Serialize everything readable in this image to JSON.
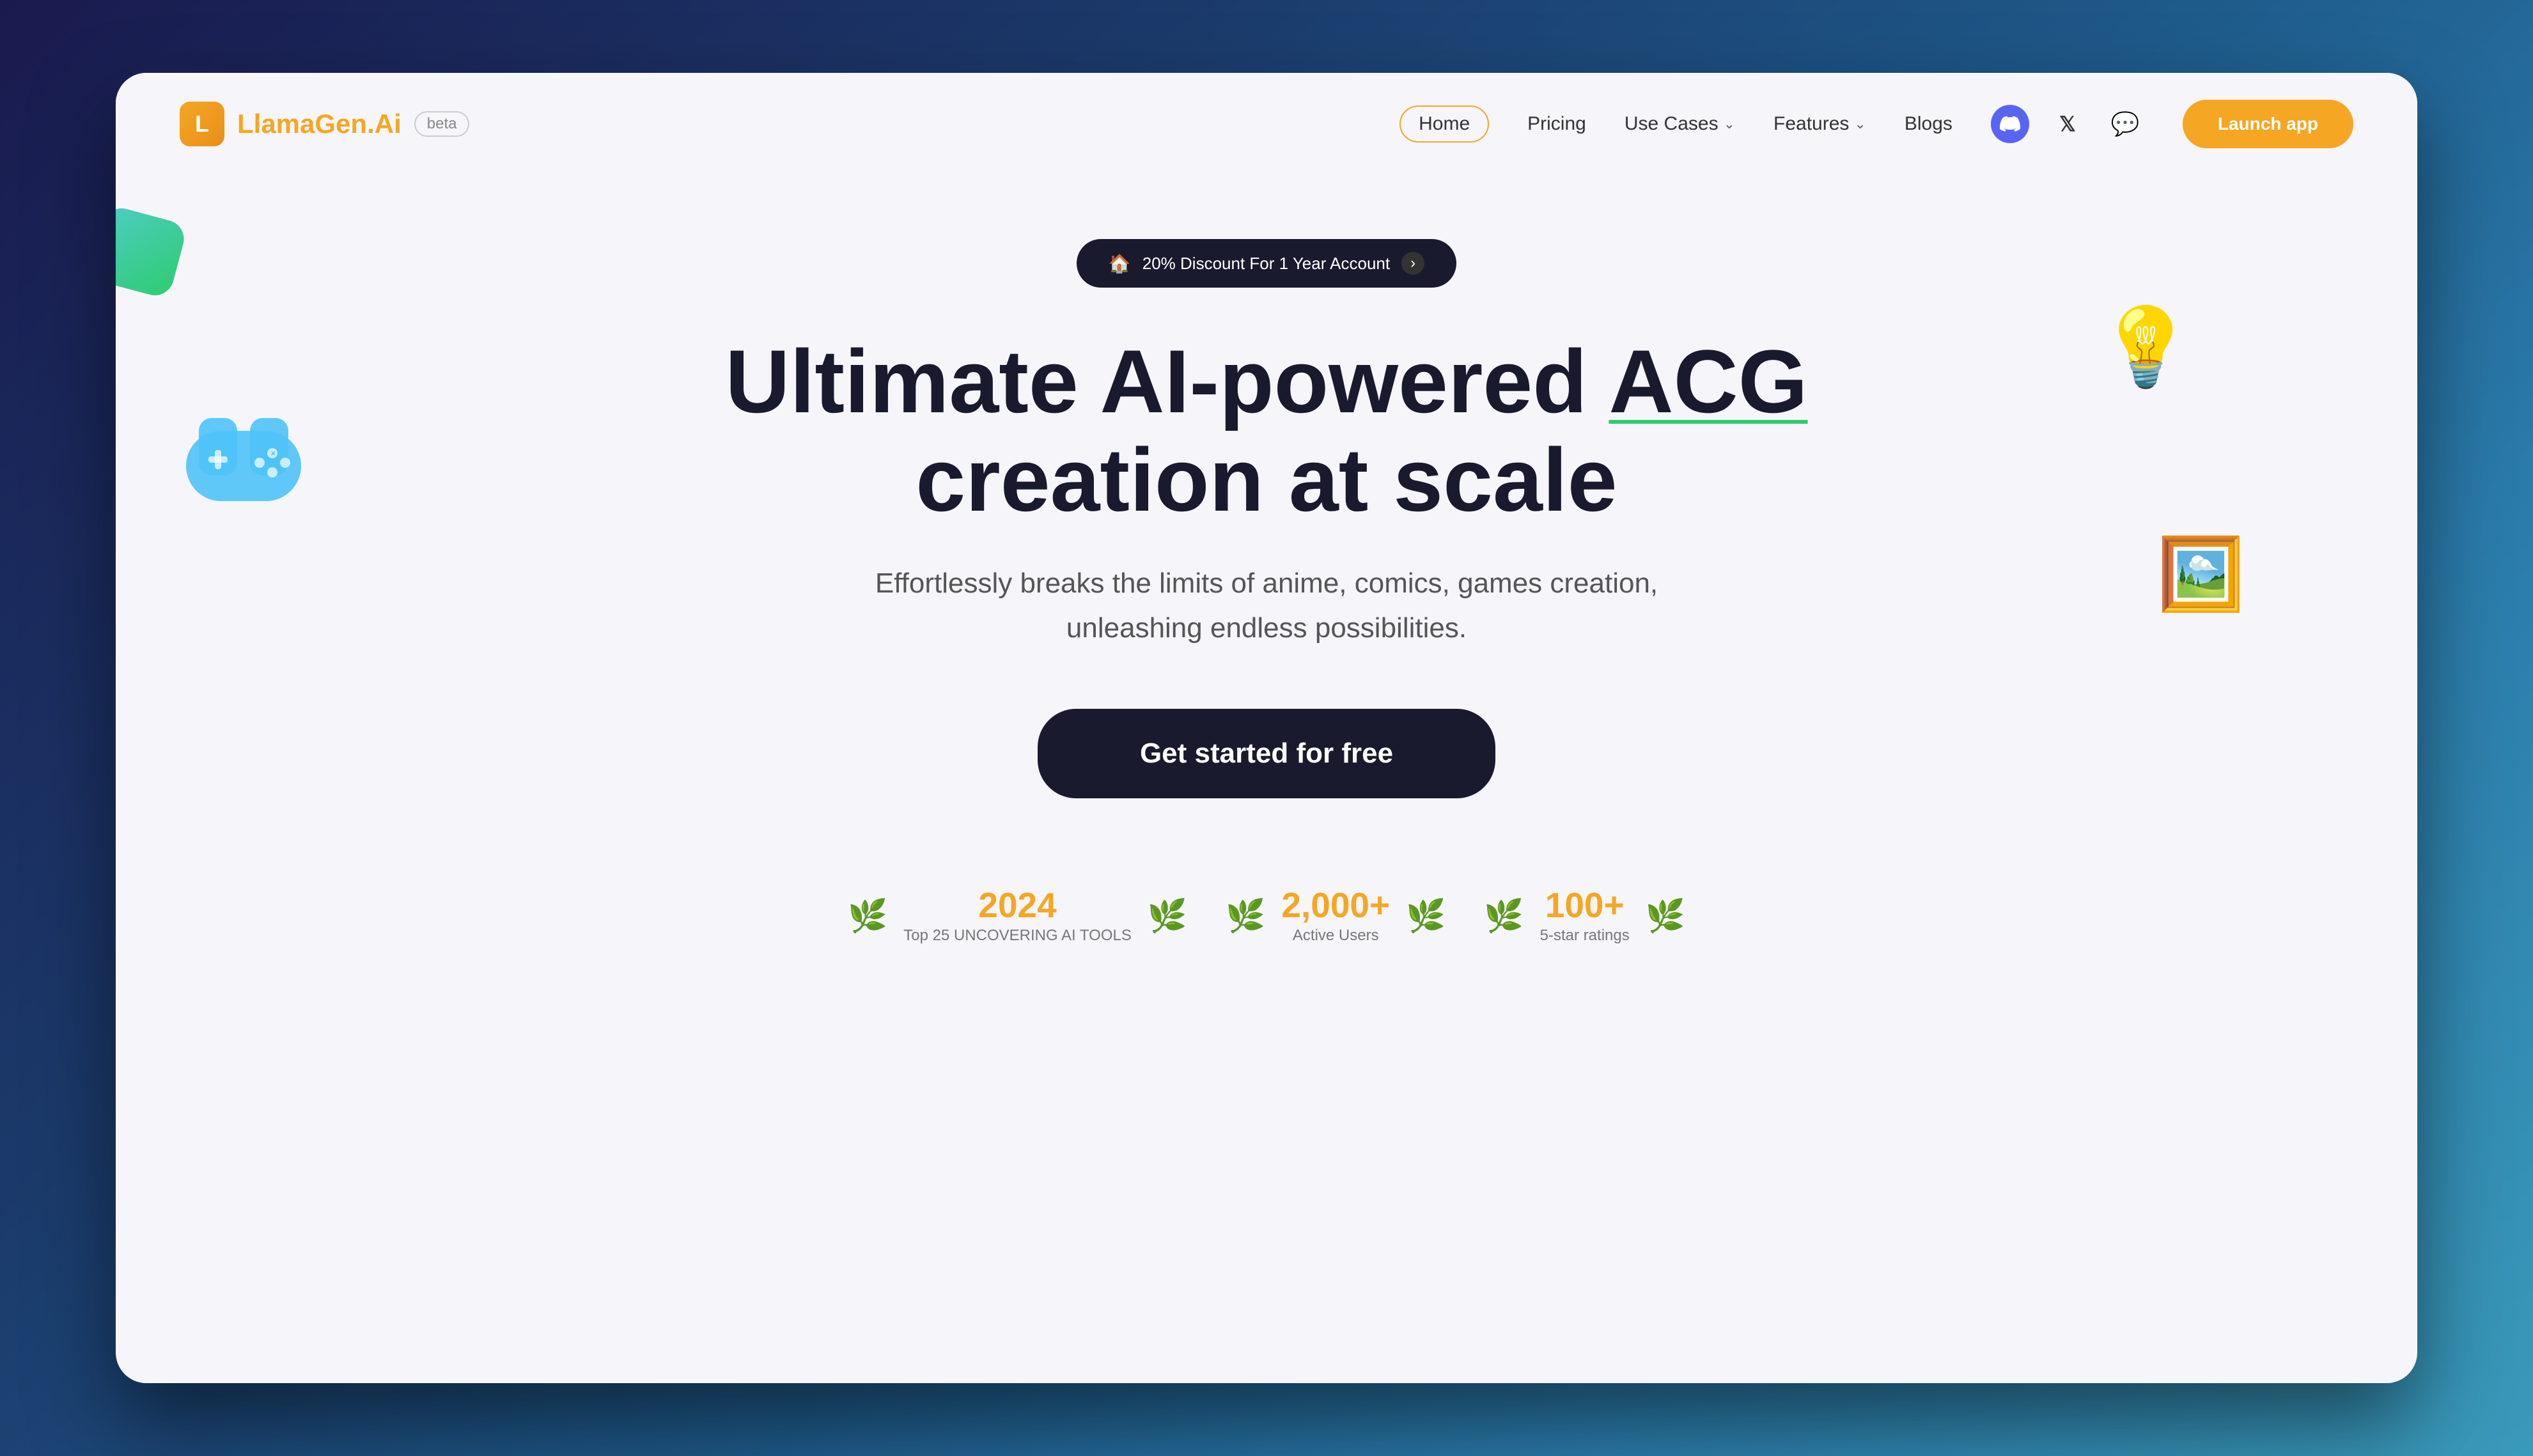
{
  "meta": {
    "title": "LlamaGen.AI",
    "beta": "beta"
  },
  "logo": {
    "icon": "L",
    "brand_first": "LlamaGen",
    "brand_second": ".Ai",
    "beta_label": "beta"
  },
  "nav": {
    "home": "Home",
    "pricing": "Pricing",
    "use_cases": "Use Cases",
    "features": "Features",
    "blogs": "Blogs",
    "launch_app": "Launch app"
  },
  "hero": {
    "discount_banner": "20% Discount For 1 Year Account",
    "headline_part1": "Ultimate AI-powered",
    "headline_acg": "ACG",
    "headline_part2": "creation at scale",
    "subheadline": "Effortlessly breaks the limits of anime, comics, games creation,\nunleashing endless possibilities.",
    "cta_label": "Get started for free"
  },
  "stats": [
    {
      "number": "2024",
      "label": "Top 25 UNCOVERING AI TOOLS"
    },
    {
      "number": "2,000+",
      "label": "Active Users"
    },
    {
      "number": "100+",
      "label": "5-star ratings"
    }
  ],
  "colors": {
    "brand_orange": "#f5a623",
    "brand_dark": "#1a1a2e",
    "accent_green": "#2ecc71",
    "discord_purple": "#5865f2"
  }
}
